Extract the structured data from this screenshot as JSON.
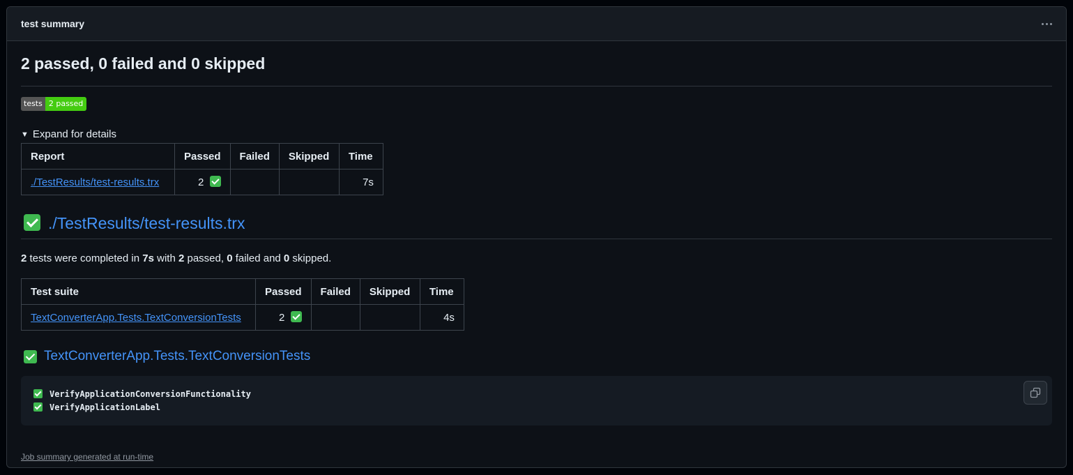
{
  "panel": {
    "title": "test summary"
  },
  "summary": {
    "heading": "2 passed, 0 failed and 0 skipped",
    "badge_left": "tests",
    "badge_right": "2 passed",
    "details_label": "Expand for details"
  },
  "report_table": {
    "headers": [
      "Report",
      "Passed",
      "Failed",
      "Skipped",
      "Time"
    ],
    "row": {
      "report": "./TestResults/test-results.trx",
      "passed": "2",
      "failed": "",
      "skipped": "",
      "time": "7s"
    }
  },
  "file_section": {
    "heading": "./TestResults/test-results.trx",
    "completed": {
      "tests": "2",
      "t1": " tests were completed in ",
      "time": "7s",
      "t2": " with ",
      "passed": "2",
      "t3": " passed, ",
      "failed": "0",
      "t4": " failed and ",
      "skipped": "0",
      "t5": " skipped."
    }
  },
  "suite_table": {
    "headers": [
      "Test suite",
      "Passed",
      "Failed",
      "Skipped",
      "Time"
    ],
    "row": {
      "suite": "TextConverterApp.Tests.TextConversionTests",
      "passed": "2",
      "failed": "",
      "skipped": "",
      "time": "4s"
    }
  },
  "suite_section": {
    "heading": "TextConverterApp.Tests.TextConversionTests",
    "tests": [
      "VerifyApplicationConversionFunctionality",
      "VerifyApplicationLabel"
    ]
  },
  "footer": {
    "link": "Job summary generated at run-time"
  },
  "colors": {
    "accent_link": "#4493f8",
    "pass_green": "#3fb950",
    "badge_green": "#44cc11",
    "background": "#0d1117"
  },
  "icons": {
    "check": "check-box-icon",
    "kebab": "kebab-horizontal-icon",
    "copy": "copy-icon"
  }
}
